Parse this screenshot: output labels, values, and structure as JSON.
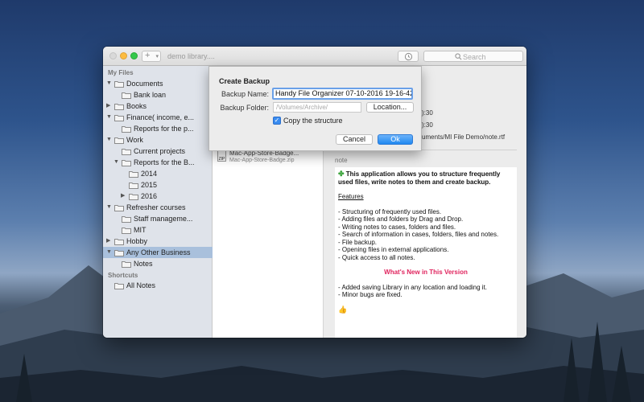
{
  "window": {
    "title": "demo library....",
    "search_placeholder": "Search"
  },
  "sidebar": {
    "section_my_files": "My Files",
    "section_shortcuts": "Shortcuts",
    "items": [
      {
        "label": "Documents"
      },
      {
        "label": "Bank loan"
      },
      {
        "label": "Books"
      },
      {
        "label": "Finance( income, e..."
      },
      {
        "label": "Reports for the p..."
      },
      {
        "label": "Work"
      },
      {
        "label": "Current projects"
      },
      {
        "label": "Reports for the B..."
      },
      {
        "label": "2014"
      },
      {
        "label": "2015"
      },
      {
        "label": "2016"
      },
      {
        "label": "Refresher courses"
      },
      {
        "label": "Staff manageme..."
      },
      {
        "label": "MIT"
      },
      {
        "label": "Hobby"
      },
      {
        "label": "Any Other Business"
      },
      {
        "label": "Notes"
      }
    ],
    "shortcuts": [
      {
        "label": "All Notes"
      }
    ]
  },
  "list": {
    "file_name": "Mac-App-Store-Badge...",
    "file_sub": "Mac-App-Store-Badge.zip",
    "zip_badge": "ZIP"
  },
  "detail": {
    "meta_time_1": "):30",
    "meta_time_2": "):30",
    "meta_path": "uments/MI File Demo/note.rtf",
    "note_label": "note",
    "note": {
      "intro": "This application allows you to structure frequently used files, write notes to them and create backup.",
      "features_heading": "Features",
      "features": [
        "- Structuring of frequently used files.",
        "- Adding files and folders by Drag and Drop.",
        "- Writing notes to cases, folders and files.",
        "- Search of information in cases, folders, files and notes.",
        "- File backup.",
        "- Opening files in external applications.",
        "- Quick access to all notes."
      ],
      "whats_new_heading": "What's New in This Version",
      "whats_new": [
        "- Added saving Library in any location and loading it.",
        "- Minor bugs are fixed."
      ]
    }
  },
  "dialog": {
    "title": "Create Backup",
    "backup_name_label": "Backup Name:",
    "backup_name_value": "Handy File Organizer 07-10-2016 19-16-42",
    "backup_folder_label": "Backup Folder:",
    "backup_folder_placeholder": "/Volumes/Archive/",
    "location_button": "Location...",
    "copy_structure_label": "Copy the structure",
    "copy_structure_checked": true,
    "cancel_button": "Cancel",
    "ok_button": "Ok"
  },
  "colors": {
    "accent": "#1f88f0",
    "selection": "#a9c0dc",
    "highlight_red": "#e0245e"
  }
}
